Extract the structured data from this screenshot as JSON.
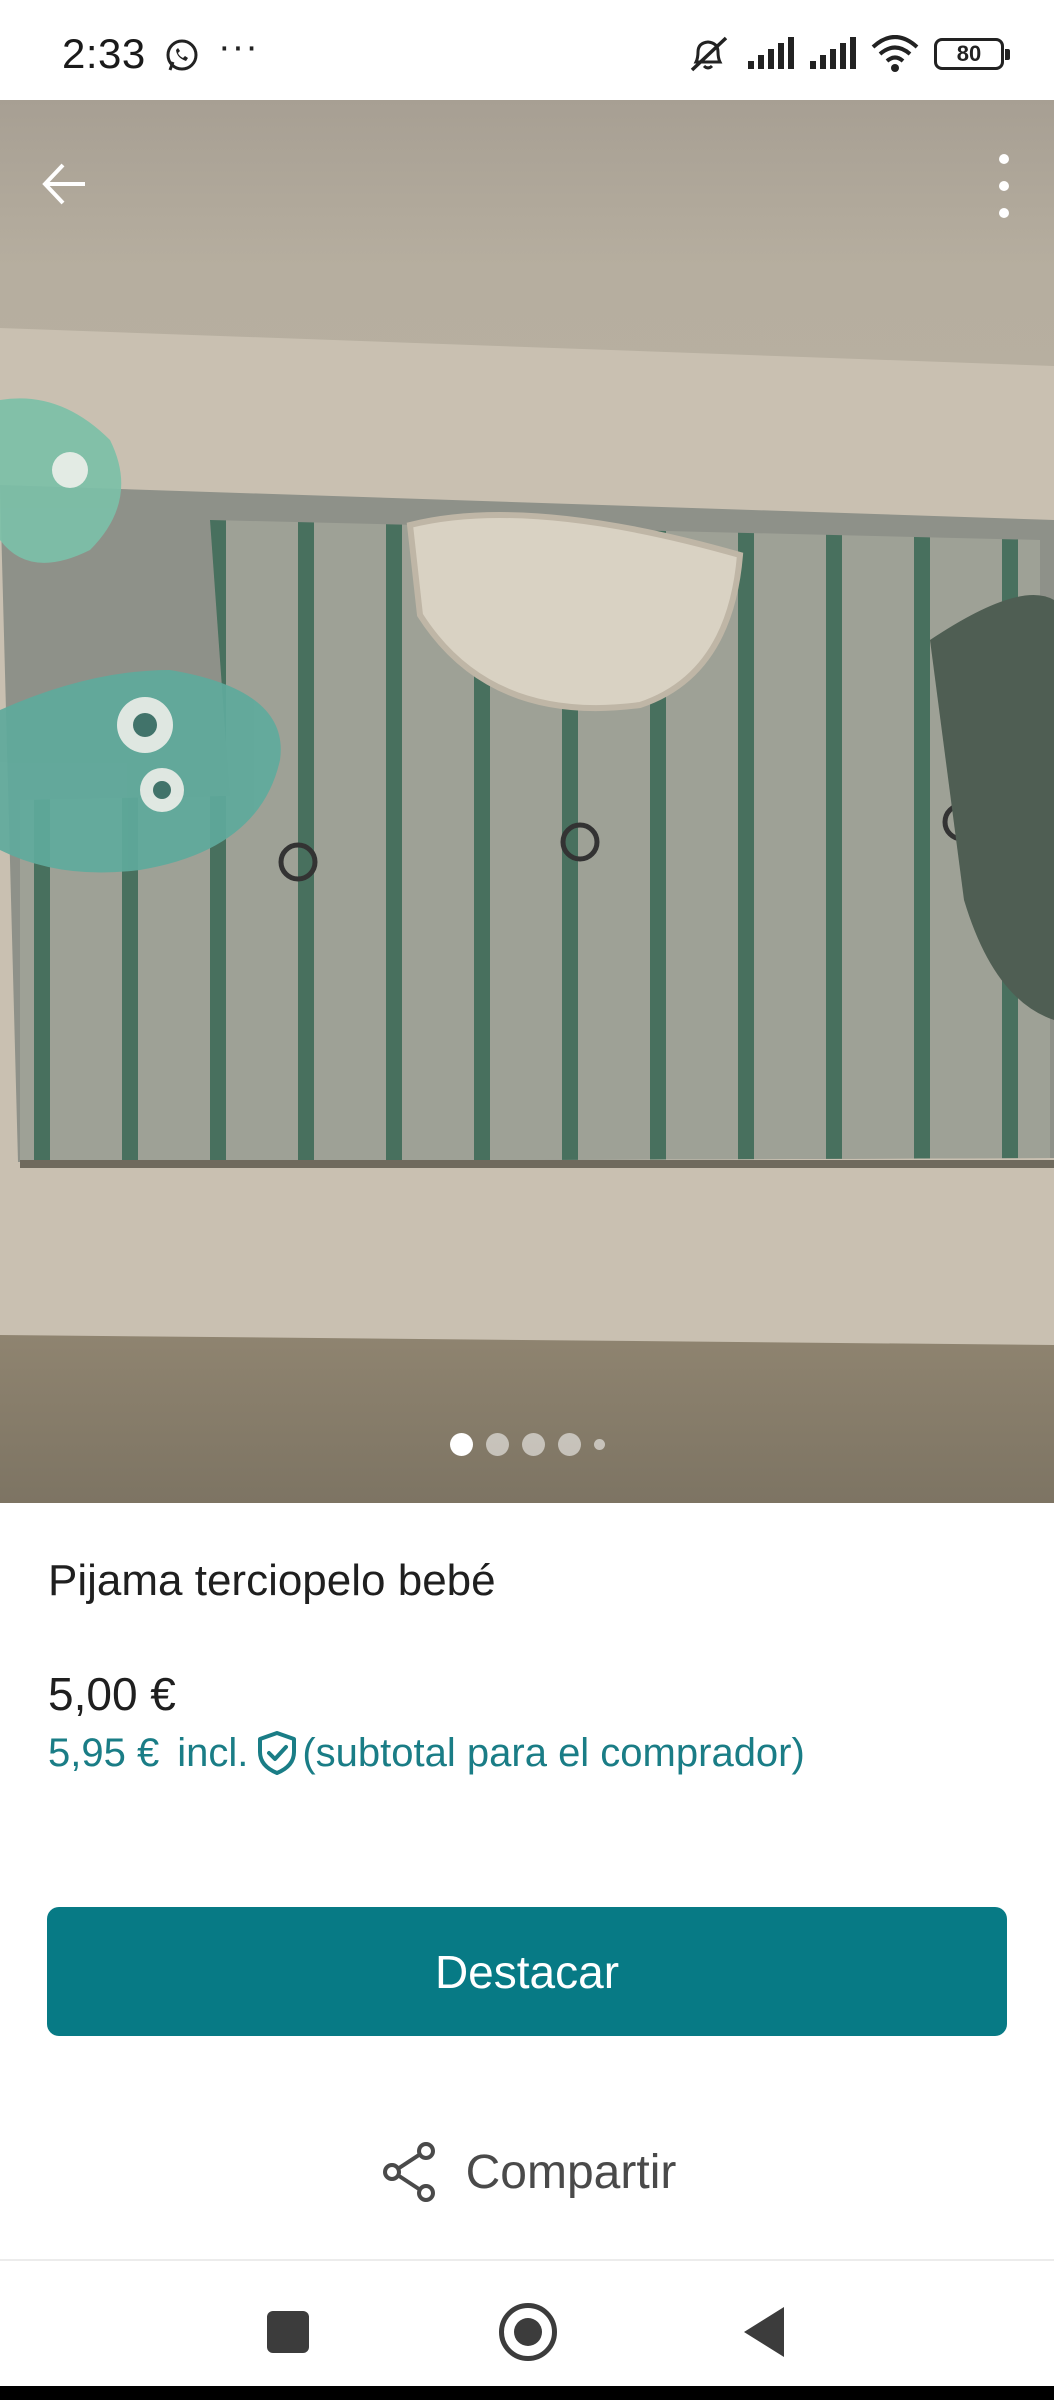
{
  "status_bar": {
    "time": "2:33",
    "overflow": "···",
    "battery": "80",
    "icons": [
      "whatsapp-icon",
      "mute-icon",
      "signal-icon",
      "signal-icon",
      "wifi-icon",
      "battery-icon"
    ]
  },
  "photo": {
    "description_icons": [
      "back-arrow-icon",
      "more-vertical-icon"
    ],
    "pager": {
      "count": 5,
      "active_index": 0
    }
  },
  "listing": {
    "title": "Pijama terciopelo bebé",
    "price": "5,00 €",
    "buyer_price": "5,95 €",
    "buyer_incl": "incl.",
    "buyer_note": "(subtotal para el comprador)"
  },
  "actions": {
    "highlight_label": "Destacar",
    "share_label": "Compartir"
  },
  "colors": {
    "accent": "#077a85",
    "accent_text": "#1a7d86",
    "text": "#1f1f1f"
  }
}
